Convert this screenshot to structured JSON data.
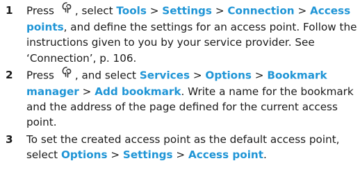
{
  "steps": [
    {
      "number": "1",
      "press": "Press",
      "mid": ", select",
      "path": [
        "Tools",
        "Settings",
        "Connection",
        "Access points"
      ],
      "text": ", and define the settings for an access point. Follow the instructions given to you by your service provider. See ‘Connection’, p. 106."
    },
    {
      "number": "2",
      "press": "Press",
      "mid": ", and select",
      "path": [
        "Services",
        "Options",
        "Bookmark manager",
        "Add bookmark"
      ],
      "text": ". Write a name for the bookmark and the address of the page defined for the current access point."
    },
    {
      "number": "3",
      "lead": "To set the created access point as the default access point, select",
      "path": [
        "Options",
        "Settings",
        "Access point"
      ],
      "end": "."
    }
  ],
  "separator": ">",
  "menu_key_icon": "menu-key-icon",
  "colors": {
    "highlight": "#1f95d6",
    "text": "#1a1a1a"
  }
}
